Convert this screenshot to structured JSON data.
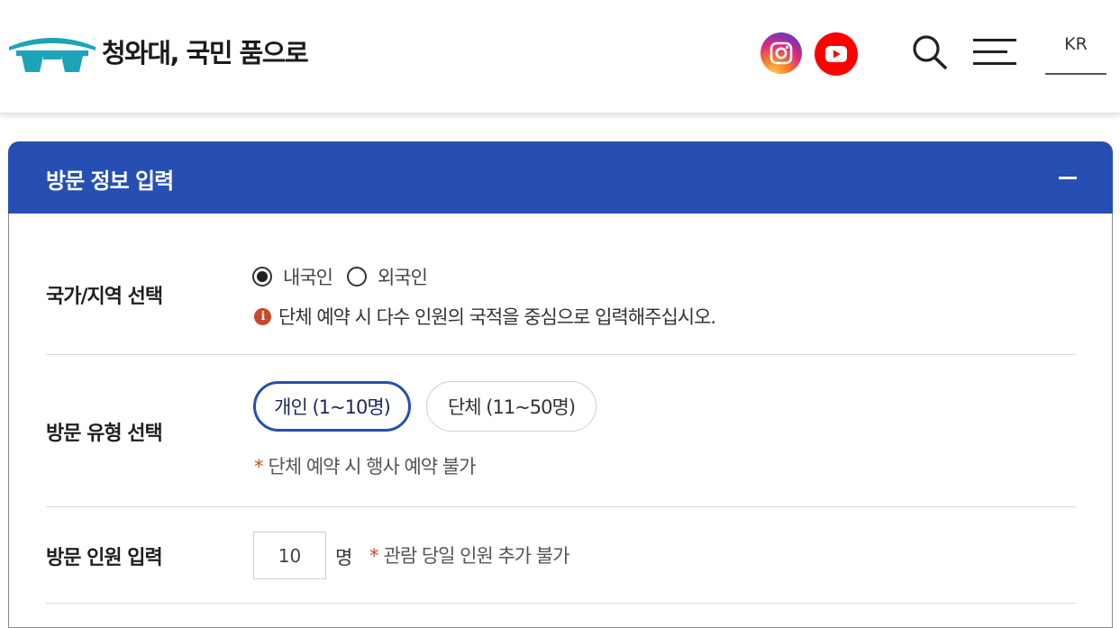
{
  "header": {
    "brand": "청와대, 국민 품으로",
    "lang": "KR"
  },
  "icons": {
    "logo": "blue-house-gate-logo",
    "instagram": "instagram-icon",
    "youtube": "youtube-icon",
    "search": "search-icon",
    "menu": "hamburger-menu-icon",
    "info": "info-icon"
  },
  "colors": {
    "accent": "#274fb3",
    "logo_teal": "#1ca3b8",
    "youtube_red": "#ff0000",
    "warning_red": "#c9482b"
  },
  "section": {
    "title": "방문 정보 입력",
    "toggle": "−"
  },
  "country": {
    "label": "국가/지역 선택",
    "options": [
      {
        "label": "내국인",
        "checked": true
      },
      {
        "label": "외국인",
        "checked": false
      }
    ],
    "info_mark": "i",
    "info": "단체 예약 시 다수 인원의 국적을 중심으로 입력해주십시오."
  },
  "visit_type": {
    "label": "방문 유형 선택",
    "options": [
      {
        "label": "개인 (1~10명)",
        "selected": true
      },
      {
        "label": "단체 (11~50명)",
        "selected": false
      }
    ],
    "note_mark": "*",
    "note": "단체 예약 시 행사 예약 불가"
  },
  "visitors": {
    "label": "방문 인원 입력",
    "value": "10",
    "unit": "명",
    "note_mark": "*",
    "note": "관람 당일 인원 추가 불가"
  }
}
